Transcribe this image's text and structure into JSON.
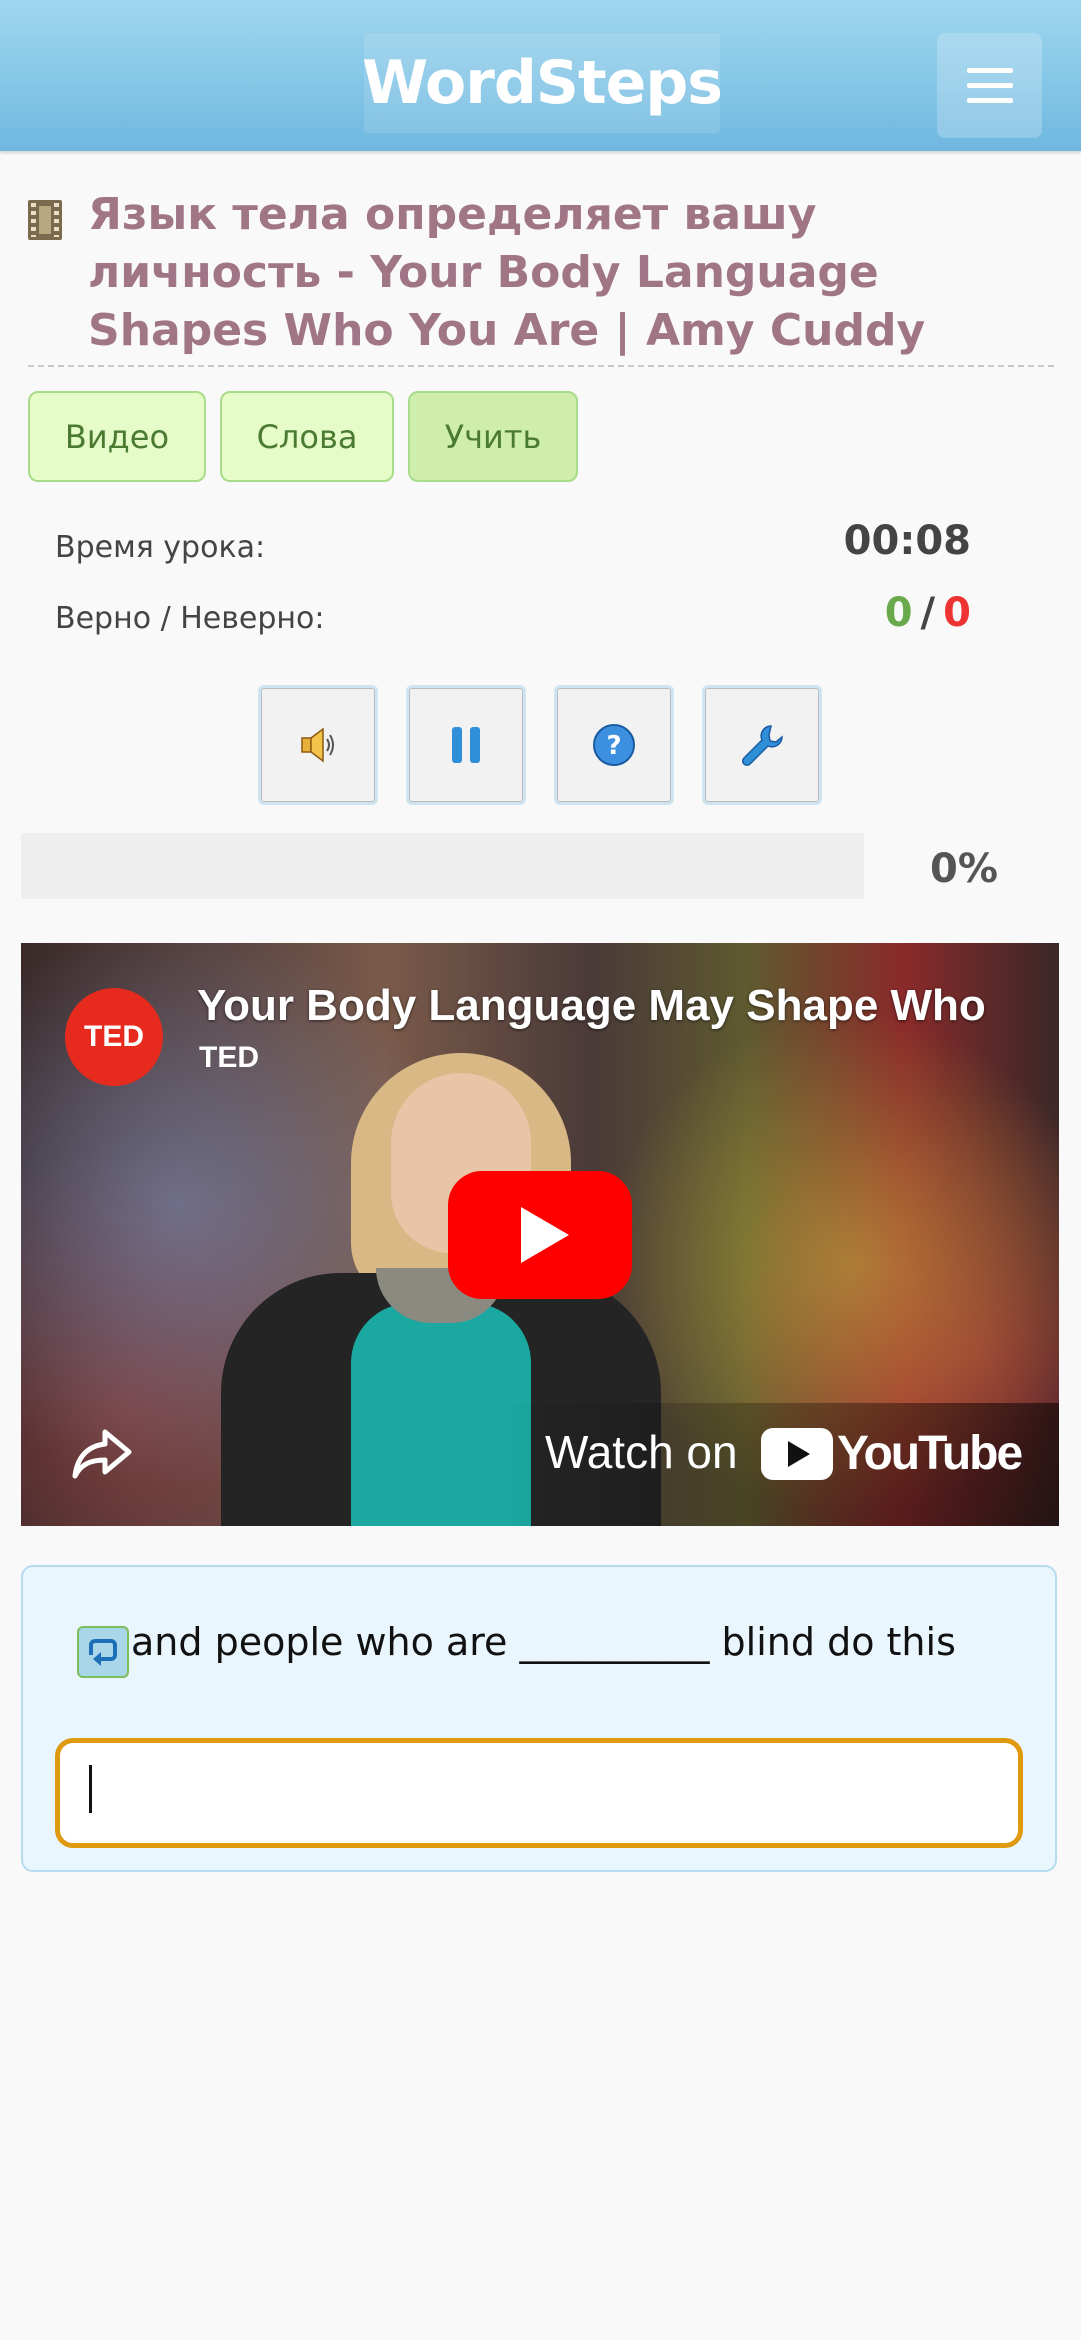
{
  "header": {
    "logo": "WordSteps",
    "menu_icon": "hamburger-icon"
  },
  "lesson": {
    "icon": "film-icon",
    "title": "Язык тела определяет вашу личность - Your Body Language Shapes Who You Are | Amy Cuddy"
  },
  "tabs": [
    {
      "label": "Видео",
      "active": false
    },
    {
      "label": "Слова",
      "active": false
    },
    {
      "label": "Учить",
      "active": true
    }
  ],
  "stats": {
    "time_label": "Время урока:",
    "time_value": "00:08",
    "score_label": "Верно / Неверно:",
    "correct": "0",
    "separator": "/",
    "wrong": "0"
  },
  "controls": [
    {
      "icon": "speaker-icon"
    },
    {
      "icon": "pause-icon"
    },
    {
      "icon": "help-icon"
    },
    {
      "icon": "wrench-icon"
    }
  ],
  "progress": {
    "value": 0,
    "label": "0%"
  },
  "video": {
    "channel_logo": "TED",
    "title": "Your Body Language May Shape Who",
    "channel": "TED",
    "watch_label": "Watch on",
    "platform": "YouTube"
  },
  "exercise": {
    "icon": "repeat-icon",
    "prompt": "and people who are __________ blind do this",
    "answer_value": ""
  },
  "colors": {
    "header": "#6fb8e0",
    "title": "#a07585",
    "tab_bg": "#e6fcc8",
    "correct": "#6aaa4c",
    "wrong": "#ee3333",
    "input_border": "#e09a10"
  }
}
